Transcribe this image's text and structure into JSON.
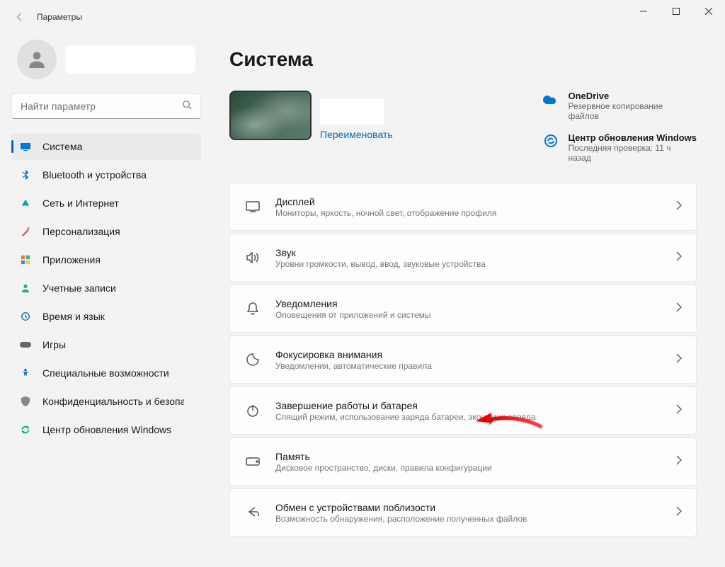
{
  "window": {
    "title": "Параметры"
  },
  "search": {
    "placeholder": "Найти параметр"
  },
  "page": {
    "title": "Система"
  },
  "device": {
    "rename": "Переименовать"
  },
  "status": {
    "onedrive": {
      "title": "OneDrive",
      "sub": "Резервное копирование файлов"
    },
    "update": {
      "title": "Центр обновления Windows",
      "sub": "Последняя проверка: 11 ч назад"
    }
  },
  "nav": [
    {
      "label": "Система"
    },
    {
      "label": "Bluetooth и устройства"
    },
    {
      "label": "Сеть и Интернет"
    },
    {
      "label": "Персонализация"
    },
    {
      "label": "Приложения"
    },
    {
      "label": "Учетные записи"
    },
    {
      "label": "Время и язык"
    },
    {
      "label": "Игры"
    },
    {
      "label": "Специальные возможности"
    },
    {
      "label": "Конфиденциальность и безопасность"
    },
    {
      "label": "Центр обновления Windows"
    }
  ],
  "settings": [
    {
      "title": "Дисплей",
      "sub": "Мониторы, яркость, ночной свет, отображение профиля"
    },
    {
      "title": "Звук",
      "sub": "Уровни громкости, вывод, ввод, звуковые устройства"
    },
    {
      "title": "Уведомления",
      "sub": "Оповещения от приложений и системы"
    },
    {
      "title": "Фокусировка внимания",
      "sub": "Уведомления, автоматические правила"
    },
    {
      "title": "Завершение работы и батарея",
      "sub": "Спящий режим, использование заряда батареи, экономия заряда"
    },
    {
      "title": "Память",
      "sub": "Дисковое пространство, диски, правила конфигурации"
    },
    {
      "title": "Обмен с устройствами поблизости",
      "sub": "Возможность обнаружения, расположение полученных файлов"
    }
  ]
}
